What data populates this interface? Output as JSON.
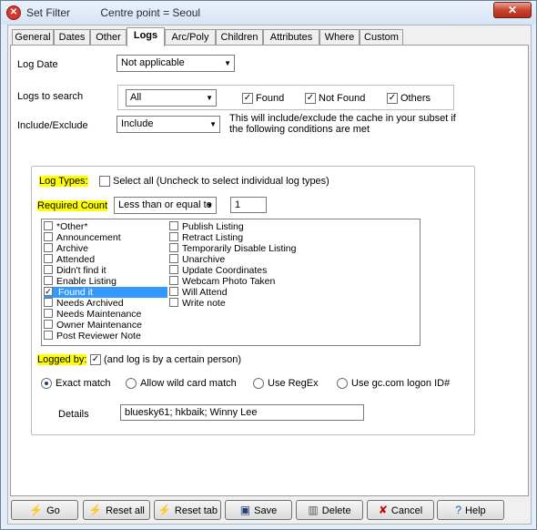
{
  "window": {
    "title": "Set Filter",
    "subtitle": "Centre point = Seoul"
  },
  "tabs": [
    "General",
    "Dates",
    "Other",
    "Logs",
    "Arc/Poly",
    "Children",
    "Attributes",
    "Where",
    "Custom"
  ],
  "active_tab": "Logs",
  "form": {
    "log_date_label": "Log Date",
    "log_date_value": "Not applicable",
    "logs_to_search_label": "Logs to search",
    "logs_to_search_value": "All",
    "found_label": "Found",
    "not_found_label": "Not Found",
    "others_label": "Others",
    "include_exclude_label": "Include/Exclude",
    "include_exclude_value": "Include",
    "include_note_line1": "This will include/exclude the cache in your subset if",
    "include_note_line2": "the following conditions are met"
  },
  "log_types": {
    "label": "Log Types:",
    "select_all_label": "Select all (Uncheck to select individual log types)",
    "required_count_label": "Required Count",
    "required_count_op": "Less than or equal to",
    "required_count_value": "1",
    "col1": [
      "*Other*",
      "Announcement",
      "Archive",
      "Attended",
      "Didn't find it",
      "Enable Listing",
      "Found it",
      "Needs Archived",
      "Needs Maintenance",
      "Owner Maintenance",
      "Post Reviewer Note"
    ],
    "col2": [
      "Publish Listing",
      "Retract Listing",
      "Temporarily Disable Listing",
      "Unarchive",
      "Update Coordinates",
      "Webcam Photo Taken",
      "Will Attend",
      "Write note"
    ],
    "checked_item": "Found it"
  },
  "logged_by": {
    "label": "Logged by:",
    "person_note": "(and log is by a certain person)",
    "match_options": [
      "Exact match",
      "Allow wild card match",
      "Use RegEx",
      "Use gc.com logon ID#"
    ],
    "details_label": "Details",
    "details_value": "bluesky61; hkbaik; Winny Lee"
  },
  "buttons": {
    "go": "Go",
    "reset_all": "Reset all",
    "reset_tab": "Reset tab",
    "save": "Save",
    "delete": "Delete",
    "cancel": "Cancel",
    "help": "Help"
  },
  "icons": {
    "app": "filter-app-icon",
    "close": "close-icon",
    "go": "lightning-icon",
    "save": "floppy-disk-icon",
    "delete": "trash-can-icon",
    "cancel": "red-x-icon",
    "help": "question-mark-icon"
  },
  "colors": {
    "highlight": "#ffff00",
    "selection": "#3399ff",
    "close_button": "#c7432f"
  }
}
